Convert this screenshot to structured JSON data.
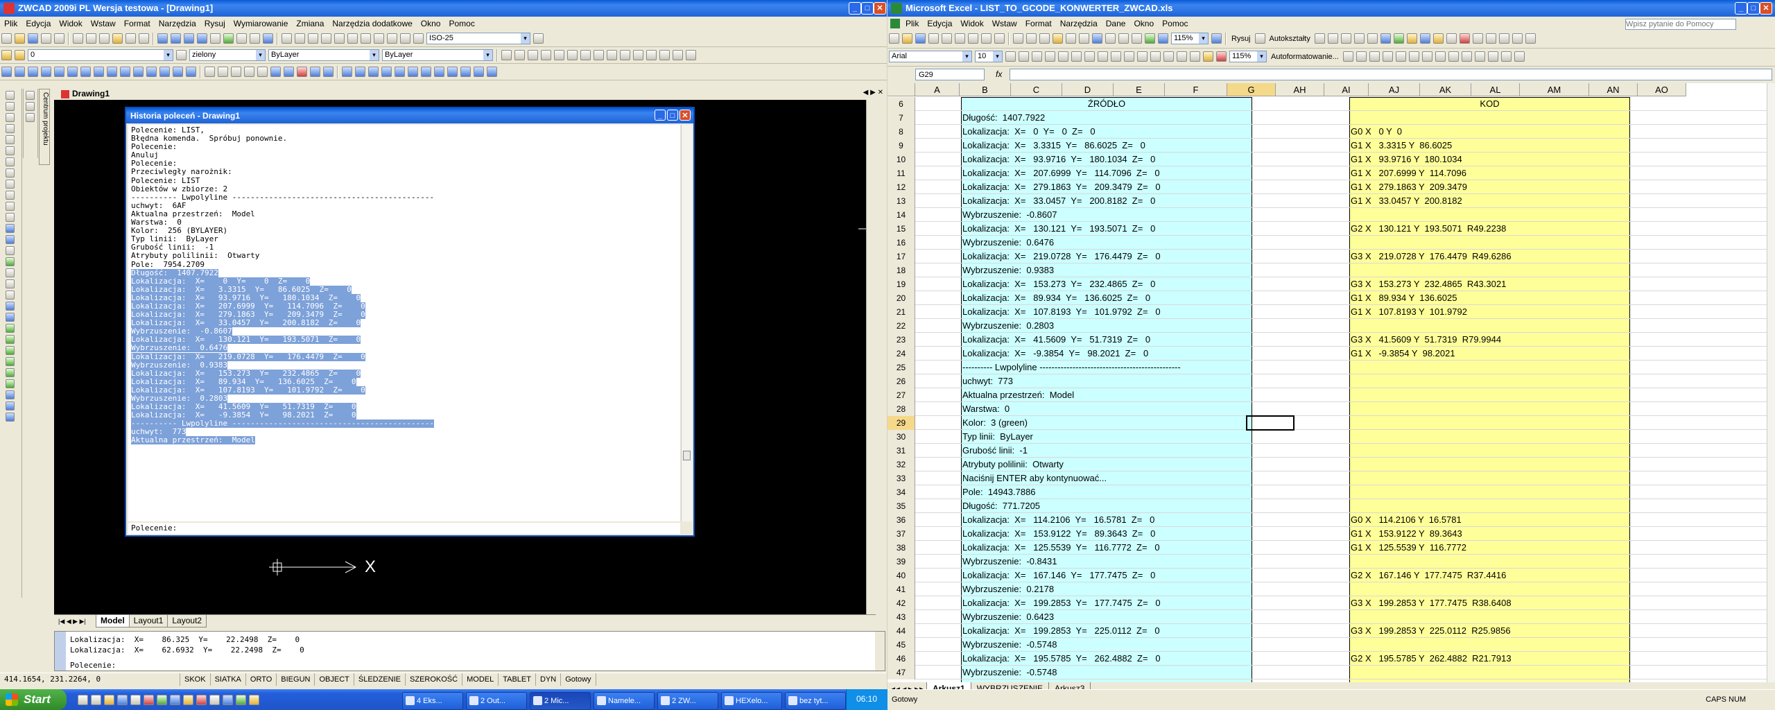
{
  "cad": {
    "title": "ZWCAD 2009i PL Wersja testowa - [Drawing1]",
    "menu": [
      "Plik",
      "Edycja",
      "Widok",
      "Wstaw",
      "Format",
      "Narzędzia",
      "Rysuj",
      "Wymiarowanie",
      "Zmiana",
      "Narzędzia dodatkowe",
      "Okno",
      "Pomoc"
    ],
    "dimstyle": "ISO-25",
    "layer": "0",
    "color": "zielony",
    "linetype": "ByLayer",
    "lineweight": "ByLayer",
    "doc_tab": "Drawing1",
    "side_panel": "Centrum projektu",
    "layout_tabs": [
      "Model",
      "Layout1",
      "Layout2"
    ],
    "history": {
      "title": "Historia poleceń - Drawing1",
      "lines": [
        "Polecenie: LIST,",
        "Błędna komenda.  Spróbuj ponownie.",
        "Polecenie:",
        "Anuluj",
        "Polecenie:",
        "Przeciwległy narożnik:",
        "Polecenie: LIST",
        "Obiektów w zbiorze: 2",
        "---------- Lwpolyline --------------------------------------------",
        "uchwyt:  6AF",
        "Aktualna przestrzeń:  Model",
        "Warstwa:  0",
        "Kolor:  256 (BYLAYER)",
        "Typ linii:  ByLayer",
        "Grubość linii:  -1",
        "Atrybuty polilinii:  Otwarty",
        "Pole:  7954.2709"
      ],
      "selected_lines": [
        "Długość:  1407.7922",
        "Lokalizacja:  X=    0  Y=    0  Z=    0",
        "Lokalizacja:  X=   3.3315  Y=   86.6025  Z=    0",
        "Lokalizacja:  X=   93.9716  Y=   180.1034  Z=    0",
        "Lokalizacja:  X=   207.6999  Y=   114.7096  Z=    0",
        "Lokalizacja:  X=   279.1863  Y=   209.3479  Z=    0",
        "Lokalizacja:  X=   33.0457  Y=   200.8182  Z=    0",
        "Wybrzuszenie:  -0.8607",
        "Lokalizacja:  X=   130.121  Y=   193.5071  Z=    0",
        "Wybrzuszenie:  0.6476",
        "Lokalizacja:  X=   219.0728  Y=   176.4479  Z=    0",
        "Wybrzuszenie:  0.9383",
        "Lokalizacja:  X=   153.273  Y=   232.4865  Z=    0",
        "Lokalizacja:  X=   89.934  Y=   136.6025  Z=    0",
        "Lokalizacja:  X=   107.8193  Y=   101.9792  Z=    0",
        "Wybrzuszenie:  0.2803",
        "Lokalizacja:  X=   41.5609  Y=   51.7319  Z=    0",
        "Lokalizacja:  X=   -9.3854  Y=   98.2021  Z=    0",
        "---------- Lwpolyline --------------------------------------------",
        "uchwyt:  773",
        "Aktualna przestrzeń:  Model"
      ],
      "prompt": "Polecenie:"
    },
    "command_lines": [
      "Lokalizacja:  X=    86.325  Y=    22.2498  Z=    0",
      "Lokalizacja:  X=    62.6932  Y=    22.2498  Z=    0"
    ],
    "command_prompt": "Polecenie:",
    "coords": "414.1654, 231.2264, 0",
    "status_buttons": [
      "SKOK",
      "SIATKA",
      "ORTO",
      "BIEGUN",
      "OBJECT",
      "ŚLEDZENIE",
      "SZEROKOŚĆ",
      "MODEL",
      "TABLET",
      "DYN",
      "Gotowy"
    ],
    "ucs_x": "X"
  },
  "excel": {
    "title": "Microsoft Excel - LIST_TO_GCODE_KONWERTER_ZWCAD.xls",
    "menu": [
      "Plik",
      "Edycja",
      "Widok",
      "Wstaw",
      "Format",
      "Narzędzia",
      "Dane",
      "Okno",
      "Pomoc"
    ],
    "help_placeholder": "Wpisz pytanie do Pomocy",
    "font": "Arial",
    "font_size": "10",
    "zoom": "115%",
    "draw_label": "Rysuj",
    "autoshapes": "Autokształty",
    "autoformat": "Autoformatowanie...",
    "namebox": "G29",
    "fx": "fx",
    "columns": [
      "A",
      "B",
      "C",
      "D",
      "E",
      "F",
      "G",
      "AH",
      "AI",
      "AJ",
      "AK",
      "AL",
      "AM",
      "AN",
      "AO"
    ],
    "header_source": "ŹRÓDŁO",
    "header_code": "KOD",
    "rows": [
      {
        "n": "6",
        "b": "",
        "ai": ""
      },
      {
        "n": "7",
        "b": "Długość:  1407.7922",
        "ai": ""
      },
      {
        "n": "8",
        "b": "Lokalizacja:  X=   0  Y=   0  Z=   0",
        "ai": "G0 X   0 Y  0"
      },
      {
        "n": "9",
        "b": "Lokalizacja:  X=   3.3315  Y=   86.6025  Z=   0",
        "ai": "G1 X   3.3315 Y  86.6025"
      },
      {
        "n": "10",
        "b": "Lokalizacja:  X=   93.9716  Y=   180.1034  Z=   0",
        "ai": "G1 X   93.9716 Y  180.1034"
      },
      {
        "n": "11",
        "b": "Lokalizacja:  X=   207.6999  Y=   114.7096  Z=   0",
        "ai": "G1 X   207.6999 Y  114.7096"
      },
      {
        "n": "12",
        "b": "Lokalizacja:  X=   279.1863  Y=   209.3479  Z=   0",
        "ai": "G1 X   279.1863 Y  209.3479"
      },
      {
        "n": "13",
        "b": "Lokalizacja:  X=   33.0457  Y=   200.8182  Z=   0",
        "ai": "G1 X   33.0457 Y  200.8182"
      },
      {
        "n": "14",
        "b": "Wybrzuszenie:  -0.8607",
        "ai": ""
      },
      {
        "n": "15",
        "b": "Lokalizacja:  X=   130.121  Y=   193.5071  Z=   0",
        "ai": "G2 X   130.121 Y  193.5071  R49.2238"
      },
      {
        "n": "16",
        "b": "Wybrzuszenie:  0.6476",
        "ai": ""
      },
      {
        "n": "17",
        "b": "Lokalizacja:  X=   219.0728  Y=   176.4479  Z=   0",
        "ai": "G3 X   219.0728 Y  176.4479  R49.6286"
      },
      {
        "n": "18",
        "b": "Wybrzuszenie:  0.9383",
        "ai": ""
      },
      {
        "n": "19",
        "b": "Lokalizacja:  X=   153.273  Y=   232.4865  Z=   0",
        "ai": "G3 X   153.273 Y  232.4865  R43.3021"
      },
      {
        "n": "20",
        "b": "Lokalizacja:  X=   89.934  Y=   136.6025  Z=   0",
        "ai": "G1 X   89.934 Y  136.6025"
      },
      {
        "n": "21",
        "b": "Lokalizacja:  X=   107.8193  Y=   101.9792  Z=   0",
        "ai": "G1 X   107.8193 Y  101.9792"
      },
      {
        "n": "22",
        "b": "Wybrzuszenie:  0.2803",
        "ai": ""
      },
      {
        "n": "23",
        "b": "Lokalizacja:  X=   41.5609  Y=   51.7319  Z=   0",
        "ai": "G3 X   41.5609 Y  51.7319  R79.9944"
      },
      {
        "n": "24",
        "b": "Lokalizacja:  X=   -9.3854  Y=   98.2021  Z=   0",
        "ai": "G1 X   -9.3854 Y  98.2021"
      },
      {
        "n": "25",
        "b": "---------- Lwpolyline -----------------------------------------------",
        "ai": ""
      },
      {
        "n": "26",
        "b": "uchwyt:  773",
        "ai": ""
      },
      {
        "n": "27",
        "b": "Aktualna przestrzeń:  Model",
        "ai": ""
      },
      {
        "n": "28",
        "b": "Warstwa:  0",
        "ai": ""
      },
      {
        "n": "29",
        "b": "Kolor:  3 (green)",
        "ai": ""
      },
      {
        "n": "30",
        "b": "Typ linii:  ByLayer",
        "ai": ""
      },
      {
        "n": "31",
        "b": "Grubość linii:  -1",
        "ai": ""
      },
      {
        "n": "32",
        "b": "Atrybuty polilinii:  Otwarty",
        "ai": ""
      },
      {
        "n": "33",
        "b": "Naciśnij ENTER aby kontynuować...",
        "ai": ""
      },
      {
        "n": "34",
        "b": "Pole:  14943.7886",
        "ai": ""
      },
      {
        "n": "35",
        "b": "Długość:  771.7205",
        "ai": ""
      },
      {
        "n": "36",
        "b": "Lokalizacja:  X=   114.2106  Y=   16.5781  Z=   0",
        "ai": "G0 X   114.2106 Y  16.5781"
      },
      {
        "n": "37",
        "b": "Lokalizacja:  X=   153.9122  Y=   89.3643  Z=   0",
        "ai": "G1 X   153.9122 Y  89.3643"
      },
      {
        "n": "38",
        "b": "Lokalizacja:  X=   125.5539  Y=   116.7772  Z=   0",
        "ai": "G1 X   125.5539 Y  116.7772"
      },
      {
        "n": "39",
        "b": "Wybrzuszenie:  -0.8431",
        "ai": ""
      },
      {
        "n": "40",
        "b": "Lokalizacja:  X=   167.146  Y=   177.7475  Z=   0",
        "ai": "G2 X   167.146 Y  177.7475  R37.4416"
      },
      {
        "n": "41",
        "b": "Wybrzuszenie:  0.2178",
        "ai": ""
      },
      {
        "n": "42",
        "b": "Lokalizacja:  X=   199.2853  Y=   177.7475  Z=   0",
        "ai": "G3 X   199.2853 Y  177.7475  R38.6408"
      },
      {
        "n": "43",
        "b": "Wybrzuszenie:  0.6423",
        "ai": ""
      },
      {
        "n": "44",
        "b": "Lokalizacja:  X=   199.2853  Y=   225.0112  Z=   0",
        "ai": "G3 X   199.2853 Y  225.0112  R25.9856"
      },
      {
        "n": "45",
        "b": "Wybrzuszenie:  -0.5748",
        "ai": ""
      },
      {
        "n": "46",
        "b": "Lokalizacja:  X=   195.5785  Y=   262.4882  Z=   0",
        "ai": "G2 X   195.5785 Y  262.4882  R21.7913"
      },
      {
        "n": "47",
        "b": "Wybrzuszenie:  -0.5748",
        "ai": ""
      }
    ],
    "sheet_tabs": [
      "Arkusz1",
      "WYBRZUSZENIE",
      "Arkusz3"
    ],
    "status_left": "Gotowy",
    "status_right": "CAPS NUM"
  },
  "taskbar": {
    "start": "Start",
    "buttons": [
      "4 Eks...",
      "2 Out...",
      "2 Mic...",
      "Namele...",
      "2 ZW...",
      "HEXelo...",
      "bez tyt..."
    ],
    "clock": "06:10"
  },
  "colors": {
    "source_fill": "#ccffff",
    "code_fill": "#ffff99",
    "selection": "#7da1d9",
    "cad_bg": "#000000",
    "taskbar": "#245edb"
  }
}
